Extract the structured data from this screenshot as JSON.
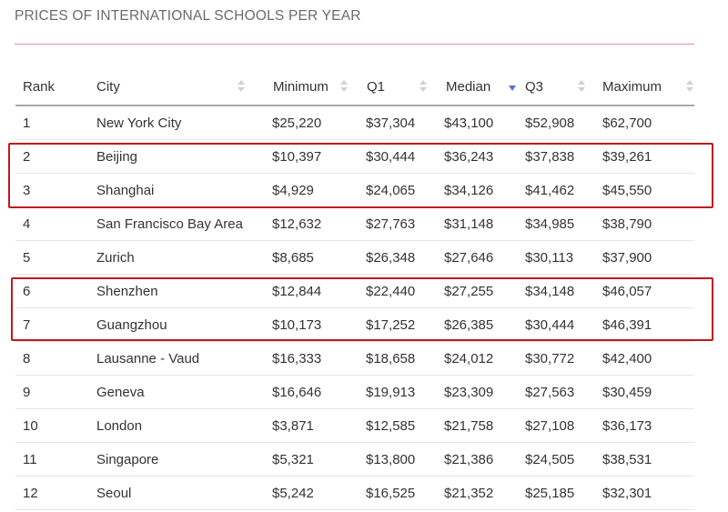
{
  "title": "PRICES OF INTERNATIONAL SCHOOLS PER YEAR",
  "colors": {
    "title_rule": "#e48ca0",
    "highlight_box": "#c0181e",
    "sort_active": "#5a6fd6"
  },
  "table": {
    "headers": [
      "Rank",
      "City",
      "Minimum",
      "Q1",
      "Median",
      "Q3",
      "Maximum"
    ],
    "sorted_column": "Median",
    "sort_direction": "descending",
    "rows": [
      [
        "1",
        "New York City",
        "$25,220",
        "$37,304",
        "$43,100",
        "$52,908",
        "$62,700"
      ],
      [
        "2",
        "Beijing",
        "$10,397",
        "$30,444",
        "$36,243",
        "$37,838",
        "$39,261"
      ],
      [
        "3",
        "Shanghai",
        "$4,929",
        "$24,065",
        "$34,126",
        "$41,462",
        "$45,550"
      ],
      [
        "4",
        "San Francisco Bay Area",
        "$12,632",
        "$27,763",
        "$31,148",
        "$34,985",
        "$38,790"
      ],
      [
        "5",
        "Zurich",
        "$8,685",
        "$26,348",
        "$27,646",
        "$30,113",
        "$37,900"
      ],
      [
        "6",
        "Shenzhen",
        "$12,844",
        "$22,440",
        "$27,255",
        "$34,148",
        "$46,057"
      ],
      [
        "7",
        "Guangzhou",
        "$10,173",
        "$17,252",
        "$26,385",
        "$30,444",
        "$46,391"
      ],
      [
        "8",
        "Lausanne - Vaud",
        "$16,333",
        "$18,658",
        "$24,012",
        "$30,772",
        "$42,400"
      ],
      [
        "9",
        "Geneva",
        "$16,646",
        "$19,913",
        "$23,309",
        "$27,563",
        "$30,459"
      ],
      [
        "10",
        "London",
        "$3,871",
        "$12,585",
        "$21,758",
        "$27,108",
        "$36,173"
      ],
      [
        "11",
        "Singapore",
        "$5,321",
        "$13,800",
        "$21,386",
        "$24,505",
        "$38,531"
      ],
      [
        "12",
        "Seoul",
        "$5,242",
        "$16,525",
        "$21,352",
        "$25,185",
        "$32,301"
      ]
    ]
  }
}
